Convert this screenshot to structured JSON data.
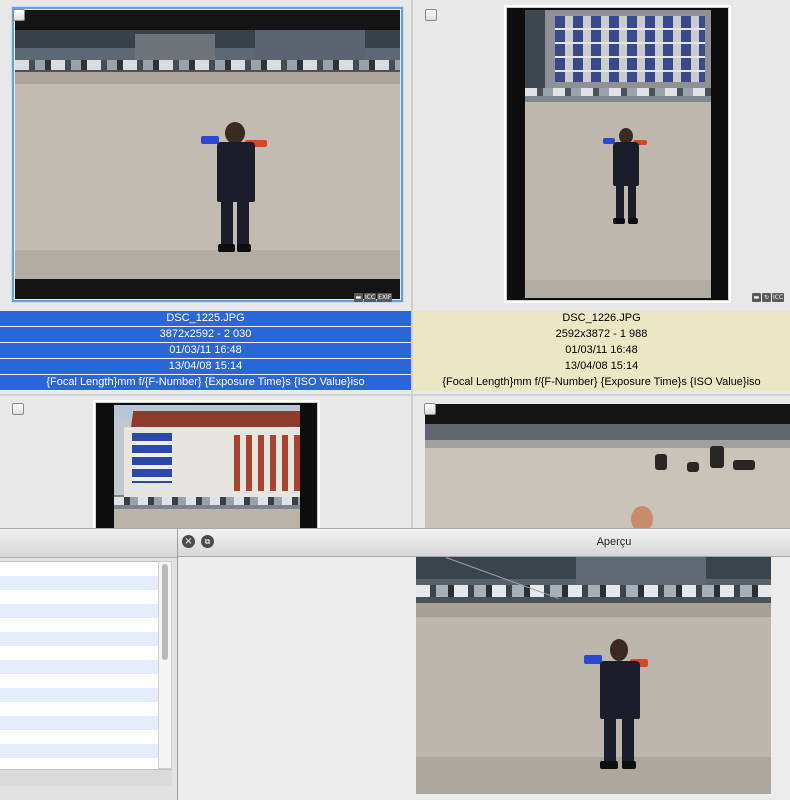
{
  "thumbnails": [
    {
      "filename": "DSC_1225.JPG",
      "dimensions": "3872x2592 - 2  030",
      "date1": "01/03/11 16:48",
      "date2": "13/04/08 15:14",
      "exif": "{Focal Length}mm f/{F-Number} {Exposure Time}s {ISO Value}iso",
      "selected": true,
      "badges": [
        "ICC",
        "EXIF"
      ]
    },
    {
      "filename": "DSC_1226.JPG",
      "dimensions": "2592x3872 - 1  988",
      "date1": "01/03/11 16:48",
      "date2": "13/04/08 15:14",
      "exif": "{Focal Length}mm f/{F-Number} {Exposure Time}s {ISO Value}iso",
      "selected": false,
      "badges": [
        "ICC"
      ]
    }
  ],
  "preview": {
    "title": "Aperçu",
    "close_icon": "close-icon",
    "detach_icon": "detach-window-icon"
  },
  "colors": {
    "selection": "#2a66d8",
    "unselected_meta": "#ebe6c4"
  }
}
